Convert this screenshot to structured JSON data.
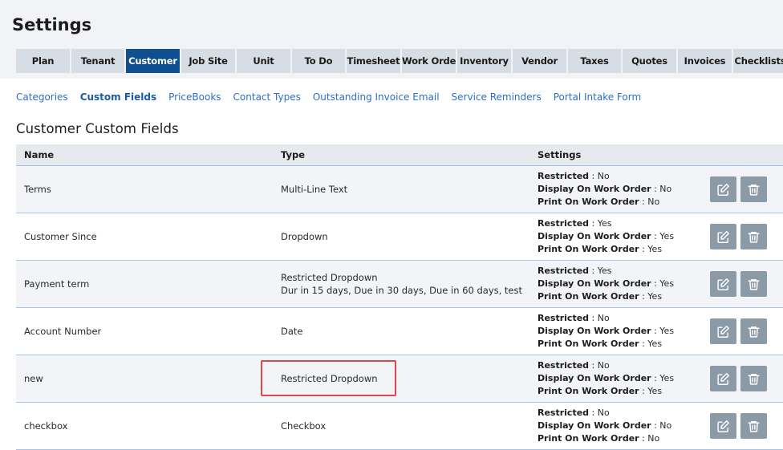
{
  "page_title": "Settings",
  "tabs": [
    {
      "label": "Plan",
      "width": 67
    },
    {
      "label": "Tenant",
      "width": 66
    },
    {
      "label": "Customer",
      "width": 67,
      "active": true
    },
    {
      "label": "Job Site",
      "width": 67
    },
    {
      "label": "Unit",
      "width": 67
    },
    {
      "label": "To Do",
      "width": 66
    },
    {
      "label": "Timesheet",
      "width": 67
    },
    {
      "label": "Work Order",
      "width": 67
    },
    {
      "label": "Inventory",
      "width": 67
    },
    {
      "label": "Vendor",
      "width": 67
    },
    {
      "label": "Taxes",
      "width": 66
    },
    {
      "label": "Quotes",
      "width": 67
    },
    {
      "label": "Invoices",
      "width": 67
    },
    {
      "label": "Checklists",
      "width": 67
    }
  ],
  "subnav": [
    {
      "label": "Categories"
    },
    {
      "label": "Custom Fields",
      "active": true
    },
    {
      "label": "PriceBooks"
    },
    {
      "label": "Contact Types"
    },
    {
      "label": "Outstanding Invoice Email"
    },
    {
      "label": "Service Reminders"
    },
    {
      "label": "Portal Intake Form"
    }
  ],
  "section_title": "Customer Custom Fields",
  "table": {
    "headers": {
      "name": "Name",
      "type": "Type",
      "settings": "Settings"
    },
    "setting_labels": {
      "restricted": "Restricted",
      "display": "Display On Work Order",
      "print": "Print On Work Order",
      "sep": " : "
    },
    "rows": [
      {
        "name": "Terms",
        "type": "Multi-Line Text",
        "type_detail": "",
        "restricted": "No",
        "display": "No",
        "print": "No"
      },
      {
        "name": "Customer Since",
        "type": "Dropdown",
        "type_detail": "",
        "restricted": "Yes",
        "display": "Yes",
        "print": "Yes"
      },
      {
        "name": "Payment term",
        "type": "Restricted Dropdown",
        "type_detail": "Dur in 15 days, Due in 30 days, Due in 60 days, test",
        "restricted": "Yes",
        "display": "Yes",
        "print": "Yes"
      },
      {
        "name": "Account Number",
        "type": "Date",
        "type_detail": "",
        "restricted": "No",
        "display": "Yes",
        "print": "Yes"
      },
      {
        "name": "new",
        "type": "Restricted Dropdown",
        "type_detail": "",
        "restricted": "No",
        "display": "Yes",
        "print": "Yes"
      },
      {
        "name": "checkbox",
        "type": "Checkbox",
        "type_detail": "",
        "restricted": "No",
        "display": "No",
        "print": "No"
      }
    ]
  },
  "icons": {
    "edit": "edit-icon",
    "delete": "trash-icon"
  },
  "colors": {
    "active_tab": "#0f4f8f",
    "link": "#2d6ec4",
    "action_button": "#8a9aa6",
    "highlight": "#e0474c"
  }
}
